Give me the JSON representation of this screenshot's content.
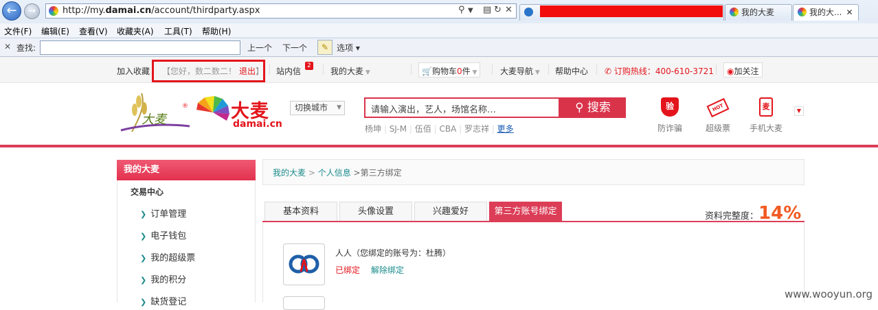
{
  "browser": {
    "url_prefix": "http://my.",
    "url_domain": "damai.cn",
    "url_path": "/account/thirdparty.aspx",
    "tabs": [
      "我的大麦",
      "我的大..."
    ],
    "menu": [
      "文件(F)",
      "编辑(E)",
      "查看(V)",
      "收藏夹(A)",
      "工具(T)",
      "帮助(H)"
    ],
    "find": {
      "label": "查找:",
      "prev": "上一个",
      "next": "下一个",
      "options": "选项"
    }
  },
  "topbar": {
    "bookmark": "加入收藏",
    "greeting": "【您好，数二数二！",
    "logout": "退出",
    "bracket_close": "】",
    "messages": "站内信",
    "message_count": "2",
    "my_damai": "我的大麦",
    "cart": "购物车",
    "cart_count": "0",
    "cart_unit": "件",
    "nav": "大麦导航",
    "help": "帮助中心",
    "hotline": "订购热线：400-610-3721",
    "follow": "加关注"
  },
  "header": {
    "brand_cn": "大麦",
    "brand_en": "damai.cn",
    "city_switch": "切换城市",
    "search_placeholder": "请输入演出，艺人，场馆名称…",
    "search_button": "搜索",
    "hot_terms": [
      "杨坤",
      "SJ-M",
      "伍佰",
      "CBA",
      "罗志祥"
    ],
    "more": "更多",
    "services": [
      {
        "icon": "验",
        "label": "防诈骗"
      },
      {
        "icon": "HOT",
        "label": "超级票"
      },
      {
        "icon": "麦",
        "label": "手机大麦"
      }
    ]
  },
  "sidebar": {
    "title": "我的大麦",
    "section": "交易中心",
    "items": [
      "订单管理",
      "电子钱包",
      "我的超级票",
      "我的积分",
      "缺货登记"
    ]
  },
  "breadcrumb": {
    "home": "我的大麦",
    "sep": " > ",
    "level2": "个人信息",
    "current": " >第三方绑定"
  },
  "tabs": [
    "基本资料",
    "头像设置",
    "兴趣爱好",
    "第三方账号绑定"
  ],
  "profile_completion": {
    "label": "资料完整度：",
    "value": "14%"
  },
  "bindings": [
    {
      "title": "人人（您绑定的账号为：杜腾）",
      "status": "已绑定",
      "action": "解除绑定"
    }
  ],
  "watermark": "www.wooyun.org",
  "colors": {
    "accent": "#dc3d57",
    "red": "#e3141b",
    "link": "#1a8a8a",
    "progress": "#f15a22"
  }
}
